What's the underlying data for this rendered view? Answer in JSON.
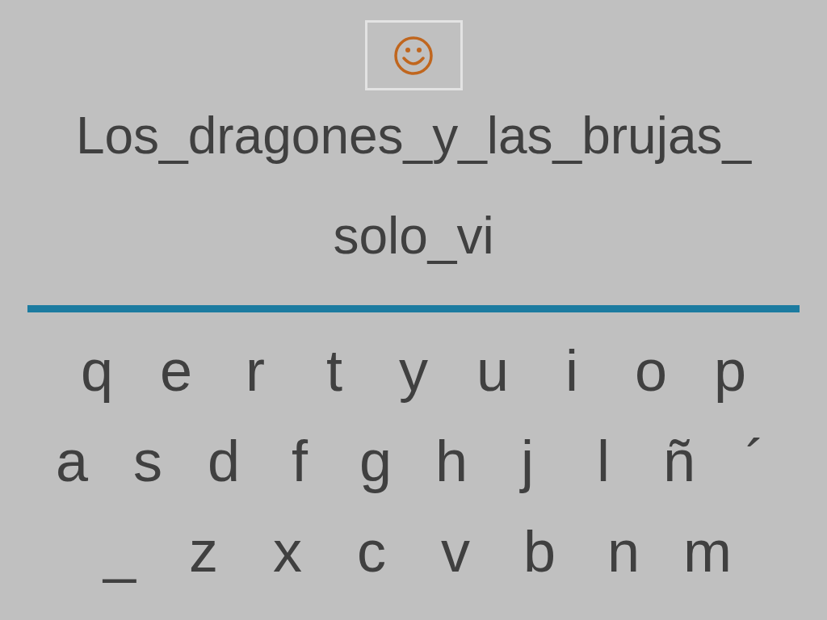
{
  "phrase_lines": [
    "Los_dragones_y_las_brujas_",
    "solo_vi"
  ],
  "keyboard": {
    "rows": [
      [
        "q",
        "e",
        "r",
        "t",
        "y",
        "u",
        "i",
        "o",
        "p"
      ],
      [
        "a",
        "s",
        "d",
        "f",
        "g",
        "h",
        "j",
        "l",
        "ñ",
        "´"
      ],
      [
        "_",
        "z",
        "x",
        "c",
        "v",
        "b",
        "n",
        "m"
      ]
    ]
  }
}
